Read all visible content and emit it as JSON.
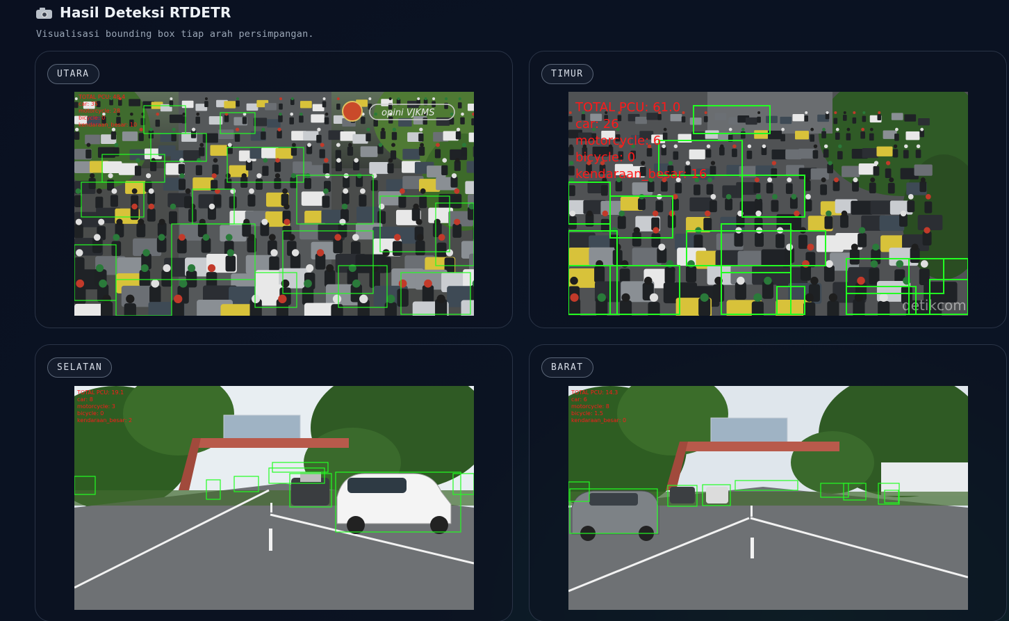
{
  "header": {
    "icon": "camera-icon",
    "title": "Hasil Deteksi RTDETR",
    "subtitle": "Visualisasi bounding box tiap arah persimpangan."
  },
  "directions": {
    "utara": {
      "label": "UTARA",
      "stats": [
        "TOTAL PCU: 48.4",
        "car: 35",
        "motorcycle: 28",
        "bicycle: 0",
        "kendaraan_besar: 10"
      ],
      "watermark": "opini VJKMS"
    },
    "timur": {
      "label": "TIMUR",
      "stats": [
        "TOTAL PCU: 61.0",
        "car: 26",
        "motorcycle: 6",
        "bicycle: 0",
        "kendaraan_besar: 16"
      ],
      "watermark": "detikcom"
    },
    "selatan": {
      "label": "SELATAN",
      "stats": [
        "TOTAL PCU: 19.1",
        "car: 8",
        "motorcycle: 3",
        "bicycle: 0",
        "kendaraan_besar: 2"
      ]
    },
    "barat": {
      "label": "BARAT",
      "stats": [
        "TOTAL PCU: 14.3",
        "car: 6",
        "motorcycle: 8",
        "bicycle: 1.5",
        "kendaraan_besar: 0"
      ]
    }
  },
  "colors": {
    "box": "#22ff22",
    "stats_text": "#ff1a1a",
    "accent": "#2a3447"
  }
}
